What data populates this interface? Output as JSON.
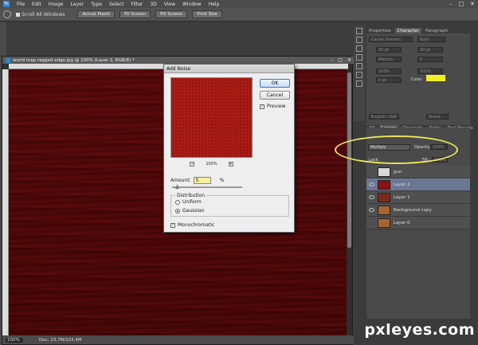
{
  "menu": {
    "items": [
      "File",
      "Edit",
      "Image",
      "Layer",
      "Type",
      "Select",
      "Filter",
      "3D",
      "View",
      "Window",
      "Help"
    ]
  },
  "options": {
    "scroll_all": "Scroll All Windows",
    "actual_pixels": "Actual Pixels",
    "fit_screen": "Fit Screen",
    "fill_screen": "Fill Screen",
    "print_size": "Print Size"
  },
  "document": {
    "tab_title": "world map ragged edge.jpg @ 100% (Layer 2, RGB/8) *",
    "zoom": "100%",
    "doc_info": "Doc: 23.7M/103.4M"
  },
  "dialog": {
    "title": "Add Noise",
    "ok": "OK",
    "cancel": "Cancel",
    "preview_label": "Preview",
    "preview_zoom": "100%",
    "amount_label": "Amount:",
    "amount_value": "5",
    "amount_unit": "%",
    "distribution_label": "Distribution",
    "uniform_label": "Uniform",
    "gaussian_label": "Gaussian",
    "mono_label": "Monochromatic",
    "preview_checked": true,
    "mono_checked": true,
    "selected_distribution": "Gaussian",
    "amount_slider_fraction": 0.05
  },
  "character": {
    "tabs": [
      "Properties",
      "Character",
      "Paragraph"
    ],
    "font_family": "Caviar Dreams",
    "font_style": "Bold",
    "size_1": "30 pt",
    "size_2": "30 pt",
    "kerning": "Metrics",
    "tracking": "0",
    "scale_v": "100%",
    "scale_h": "100%",
    "baseline": "0 pt",
    "color_label": "Color:",
    "color_hex": "#f1ee23",
    "language": "English: USA",
    "aa": "Sharp"
  },
  "layers": {
    "tabs": [
      "3D",
      "Layers",
      "Channels",
      "Paths",
      "Tool Presets"
    ],
    "blend_mode": "Multiply",
    "opacity_label": "Opacity:",
    "opacity_value": "100%",
    "lock_label": "Lock:",
    "fill_label": "Fill:",
    "fill_value": "100%",
    "items": [
      {
        "name": "gun",
        "thumb_color": "#d8d8d8",
        "visible": false
      },
      {
        "name": "Layer 2",
        "thumb_color": "#8a1212",
        "visible": true,
        "selected": true
      },
      {
        "name": "Layer 1",
        "thumb_color": "#7a2b1e",
        "visible": true
      },
      {
        "name": "Background copy",
        "thumb_color": "#a8632f",
        "visible": true
      },
      {
        "name": "Layer 0",
        "thumb_color": "#a8632f",
        "visible": false
      }
    ]
  },
  "watermark": "pxleyes.com",
  "colors": {
    "highlight_yellow": "#f2ef2a",
    "selection_blue": "#6b7893",
    "canvas_red": "#5c0a0c"
  }
}
